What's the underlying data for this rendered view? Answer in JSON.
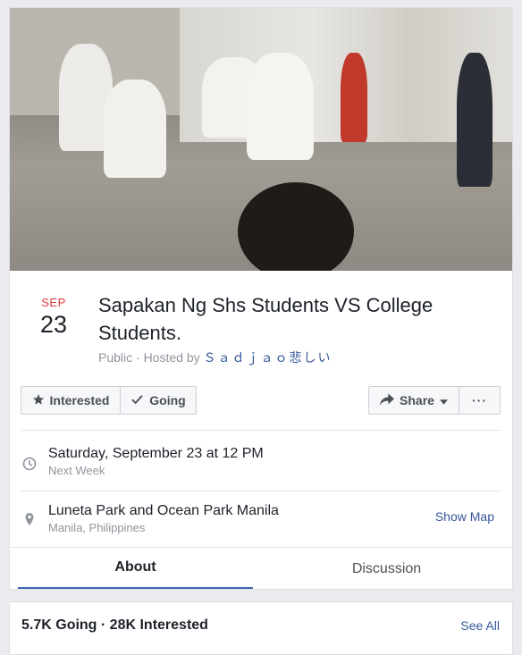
{
  "event": {
    "date": {
      "month": "SEP",
      "day": "23"
    },
    "title": "Sapakan Ng Shs Students VS College Students.",
    "visibility": "Public",
    "hosted_by_prefix": "· Hosted by",
    "host_name": "Ｓａｄｊａｏ悲しい"
  },
  "actions": {
    "interested_label": "Interested",
    "going_label": "Going",
    "share_label": "Share",
    "more_label": "···"
  },
  "details": {
    "time_main": "Saturday, September 23 at 12 PM",
    "time_sub": "Next Week",
    "location_main": "Luneta Park and Ocean Park Manila",
    "location_sub": "Manila, Philippines",
    "show_map_label": "Show Map"
  },
  "tabs": [
    {
      "label": "About",
      "active": true
    },
    {
      "label": "Discussion",
      "active": false
    }
  ],
  "stats": {
    "summary": "5.7K Going · 28K Interested",
    "see_all_label": "See All"
  },
  "colors": {
    "accent": "#4267b2",
    "link": "#365899",
    "date_month": "#e0393e",
    "muted": "#90949c"
  },
  "icons": {
    "interested": "star-icon",
    "going": "check-icon",
    "share": "share-arrow-icon",
    "share_dropdown": "caret-down-icon",
    "time": "clock-icon",
    "location": "map-pin-icon"
  }
}
